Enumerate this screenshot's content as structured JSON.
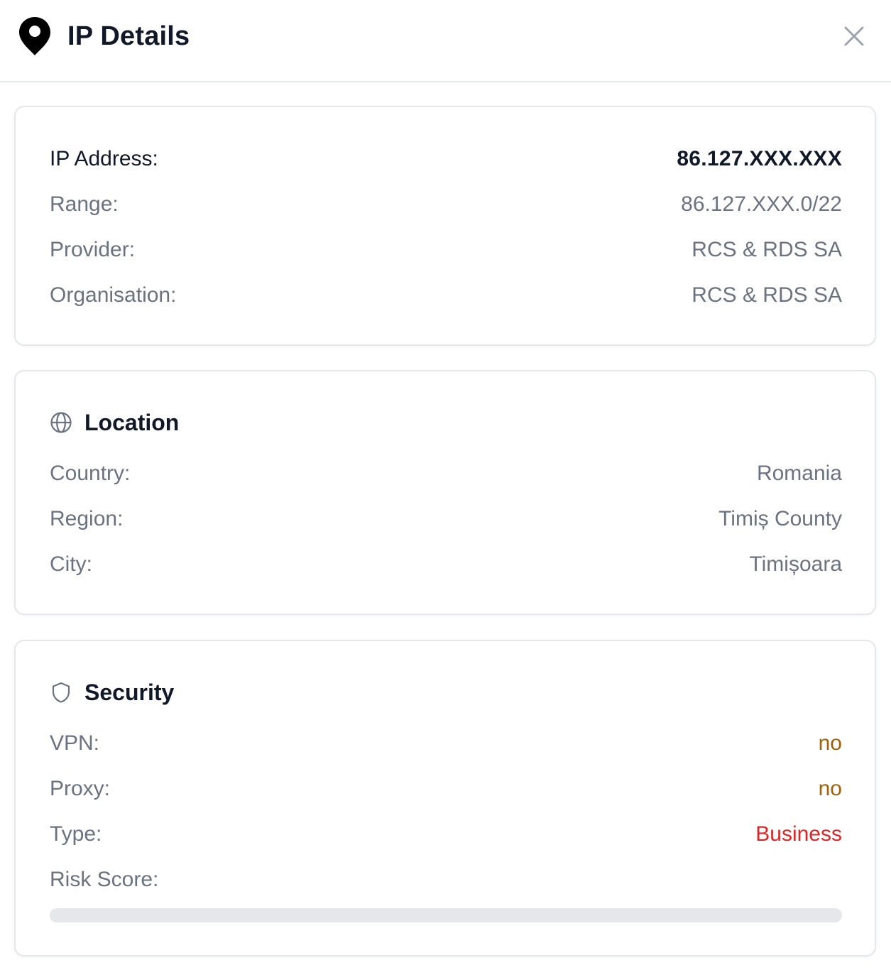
{
  "header": {
    "title": "IP Details",
    "icon": "map-pin-icon",
    "close_icon": "close-icon"
  },
  "ip_card": {
    "rows": [
      {
        "label": "IP Address:",
        "value": "86.127.XXX.XXX"
      },
      {
        "label": "Range:",
        "value": "86.127.XXX.0/22"
      },
      {
        "label": "Provider:",
        "value": "RCS & RDS SA"
      },
      {
        "label": "Organisation:",
        "value": "RCS & RDS SA"
      }
    ]
  },
  "location": {
    "title": "Location",
    "icon": "globe-icon",
    "rows": [
      {
        "label": "Country:",
        "value": "Romania"
      },
      {
        "label": "Region:",
        "value": "Timiș County"
      },
      {
        "label": "City:",
        "value": "Timișoara"
      }
    ]
  },
  "security": {
    "title": "Security",
    "icon": "shield-icon",
    "rows": [
      {
        "label": "VPN:",
        "value": "no"
      },
      {
        "label": "Proxy:",
        "value": "no"
      },
      {
        "label": "Type:",
        "value": "Business"
      }
    ],
    "risk_score": {
      "label": "Risk Score:",
      "fill_fraction": 0
    }
  },
  "colors": {
    "text_dark": "#111827",
    "text_muted": "#6b7280",
    "border": "#e5e7eb",
    "amber": "#a16207",
    "red": "#dc2626"
  }
}
